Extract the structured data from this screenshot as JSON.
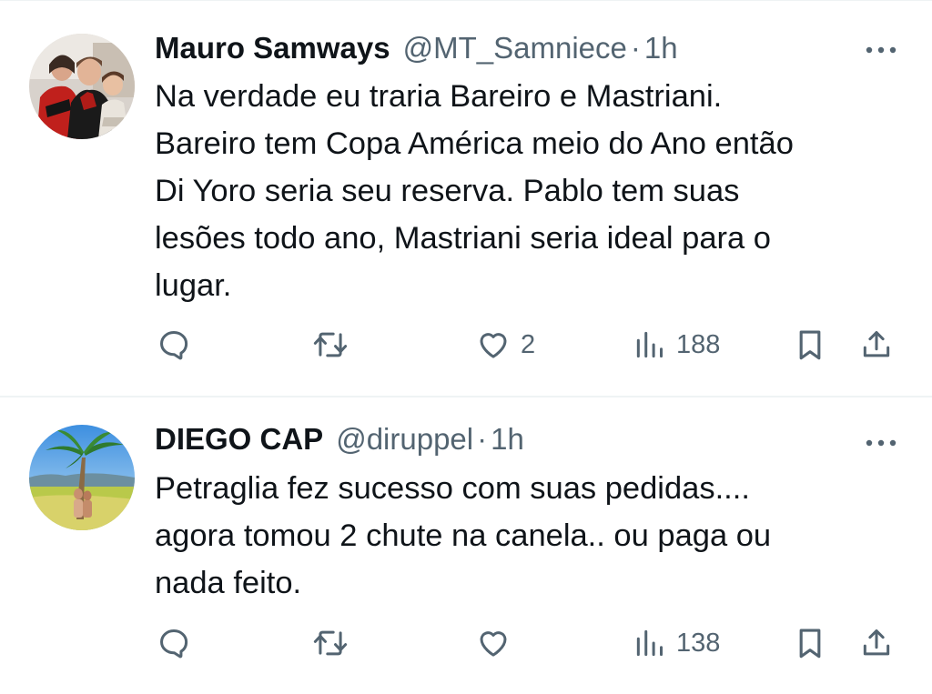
{
  "tweets": [
    {
      "display_name": "Mauro Samways",
      "handle": "@MT_Samniece",
      "separator": "·",
      "time": "1h",
      "text": "Na verdade eu traria Bareiro e Mastriani.\nBareiro tem Copa América meio do Ano então\nDi Yoro seria seu reserva. Pablo tem suas\nlesões todo ano, Mastriani seria ideal para o\nlugar.",
      "reply_count": "",
      "retweet_count": "",
      "like_count": "2",
      "view_count": "188",
      "avatar": "family-photo-avatar"
    },
    {
      "display_name": "DIEGO CAP",
      "handle": "@diruppel",
      "separator": "·",
      "time": "1h",
      "text": "Petraglia fez sucesso com suas pedidas....\nagora tomou 2 chute na canela.. ou paga ou\nnada feito.",
      "reply_count": "",
      "retweet_count": "",
      "like_count": "",
      "view_count": "138",
      "avatar": "palm-tree-photo-avatar"
    }
  ],
  "icons": {
    "reply": "speech-bubble-icon",
    "retweet": "retweet-arrows-icon",
    "like": "heart-outline-icon",
    "views": "bar-chart-icon",
    "bookmark": "bookmark-icon",
    "share": "share-upload-icon",
    "more": "more-dots-icon"
  },
  "colors": {
    "text_primary": "#0f1419",
    "text_secondary": "#536471",
    "divider": "#eff3f4"
  }
}
